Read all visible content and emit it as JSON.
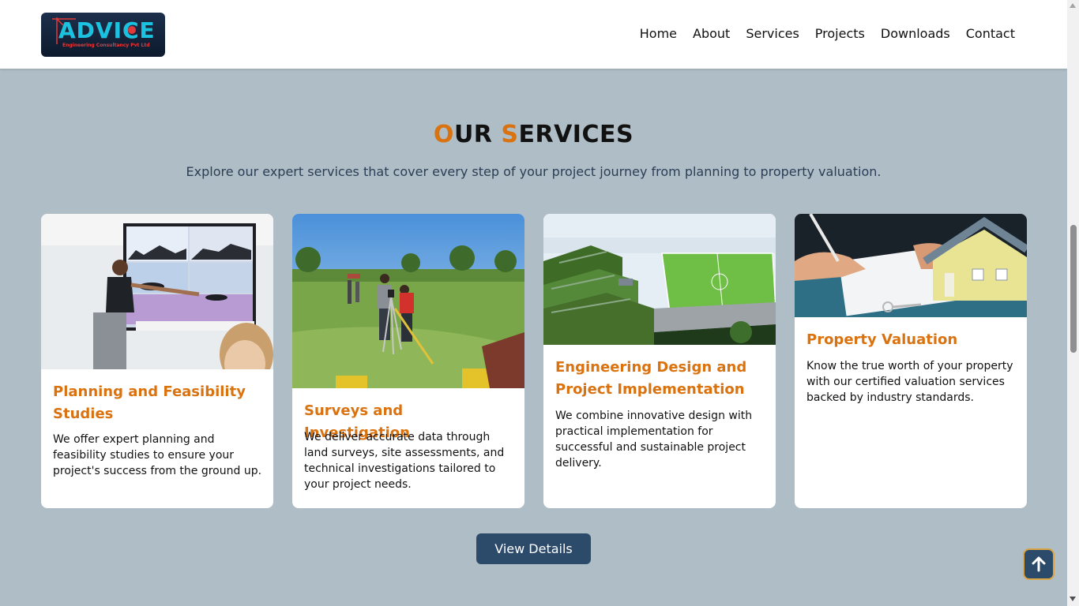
{
  "brand": {
    "logo_word": "ADVICE",
    "logo_sub": "Engineering Consultancy Pvt Ltd"
  },
  "nav": {
    "items": [
      "Home",
      "About",
      "Services",
      "Projects",
      "Downloads",
      "Contact"
    ]
  },
  "section": {
    "title_first_letter": "O",
    "title_first_rest": "UR",
    "title_second_letter": "S",
    "title_second_rest": "ERVICES",
    "subtitle": "Explore our expert services that cover every step of your project journey from planning to property valuation."
  },
  "cards": [
    {
      "title": "Planning and Feasibility Studies",
      "desc": "We offer expert planning and feasibility studies to ensure your project's success from the ground up.",
      "image": "presentation-photo"
    },
    {
      "title": "Surveys and Investigation",
      "desc": "We deliver accurate data through land surveys, site assessments, and technical investigations tailored to your project needs.",
      "image": "land-survey-photo"
    },
    {
      "title": "Engineering Design and Project Implementation",
      "desc": "We combine innovative design with practical implementation for successful and sustainable project delivery.",
      "image": "stadium-render"
    },
    {
      "title": "Property Valuation",
      "desc": "Know the true worth of your property with our certified valuation services backed by industry standards.",
      "image": "house-model-photo"
    }
  ],
  "actions": {
    "view_details": "View Details",
    "scroll_top_icon": "arrow-up-icon"
  },
  "colors": {
    "accent": "#d9720f",
    "navy": "#2c4a6a",
    "page_bg": "#aebdc6"
  }
}
